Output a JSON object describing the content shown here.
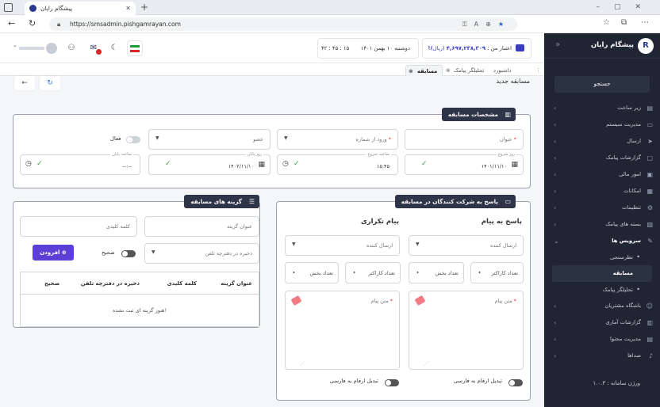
{
  "browser": {
    "tab_title": "پیشگام رایان",
    "url": "https://smsadmin.pishgamrayan.com"
  },
  "sidebar": {
    "brand": "پیشگام رایان",
    "search_label": "جستجو",
    "items": [
      {
        "label": "زیر ساخت",
        "icon": "server-icon"
      },
      {
        "label": "مدیریت سیستم",
        "icon": "monitor-icon"
      },
      {
        "label": "ارسال",
        "icon": "send-icon"
      },
      {
        "label": "گزارشات پیامک",
        "icon": "chat-icon"
      },
      {
        "label": "امور مالی",
        "icon": "wallet-icon"
      },
      {
        "label": "امکانات",
        "icon": "grid-icon"
      },
      {
        "label": "تنظیمات",
        "icon": "gear-icon"
      },
      {
        "label": "بسته های پیامک",
        "icon": "package-icon"
      },
      {
        "label": "سرویس ها",
        "icon": "plug-icon"
      },
      {
        "label": "نظرسنجی",
        "icon": "dot"
      },
      {
        "label": "مسابقه",
        "icon": "dot"
      },
      {
        "label": "تحلیلگر پیامک",
        "icon": "dot"
      },
      {
        "label": "باشگاه مشتریان",
        "icon": "users-icon"
      },
      {
        "label": "گزارشات آماری",
        "icon": "chart-icon"
      },
      {
        "label": "مدیریت محتوا",
        "icon": "content-icon"
      },
      {
        "label": "صداها",
        "icon": "music-icon"
      }
    ],
    "version": "ورژن سامانه : ۱.۰.۳"
  },
  "header": {
    "credit_label": "اعتبار من :",
    "credit_value": "۴,۶۹۷,۲۳۸,۳۰۹",
    "credit_unit": "(ریال)",
    "date": "دوشنبه ۱۰ بهمن ۱۴۰۱",
    "time": "۴۲ : ۴۵ : ۱۵"
  },
  "page_tabs": [
    {
      "label": "داشبورد"
    },
    {
      "label": "تحلیلگر پیامک"
    },
    {
      "label": "مسابقه"
    }
  ],
  "page": {
    "title": "مسابقه جدید"
  },
  "contest_specs": {
    "title": "مشخصات مسابقه",
    "title_placeholder": "عنوان",
    "phone_placeholder": "ورود از شماره",
    "member_select": "عضو",
    "active_label": "فعال",
    "start_day_label": "روز شروع",
    "start_day_value": "۱۴۰۱/۱۱/۱۰",
    "start_time_label": "ساعت شروع",
    "start_time_value": "۱۵:۴۵",
    "end_day_label": "روز پایان",
    "end_day_value": "۱۴۰۲/۱۱/۱۰",
    "end_time_label": "ساعت پایان",
    "end_time_value": "--:--"
  },
  "reply": {
    "title": "پاسخ به شرکت کنندگان در مسابقه",
    "col_reply": "پاسخ به پیام",
    "col_repeat": "پیام تکراری",
    "sender_placeholder": "ارسال کننده",
    "char_count": "تعداد کاراکتر",
    "part_count": "تعداد بخش",
    "message_placeholder": "متن پیام",
    "convert_label": "تبدیل ارقام به فارسی"
  },
  "options": {
    "title": "گزینه های مسابقه",
    "option_title_placeholder": "عنوان گزینه",
    "keyword_placeholder": "کلمه کلیدی",
    "phonebook_placeholder": "ذخیره در دفترچه تلفن",
    "correct_label": "صحیح",
    "add_button": "افزودن",
    "table_headers": [
      "عنوان گزینه",
      "کلمه کلیدی",
      "ذخیره در دفترچه تلفن",
      "صحیح"
    ],
    "empty_text": "هنوز گزینه ای ثبت نشده!"
  }
}
